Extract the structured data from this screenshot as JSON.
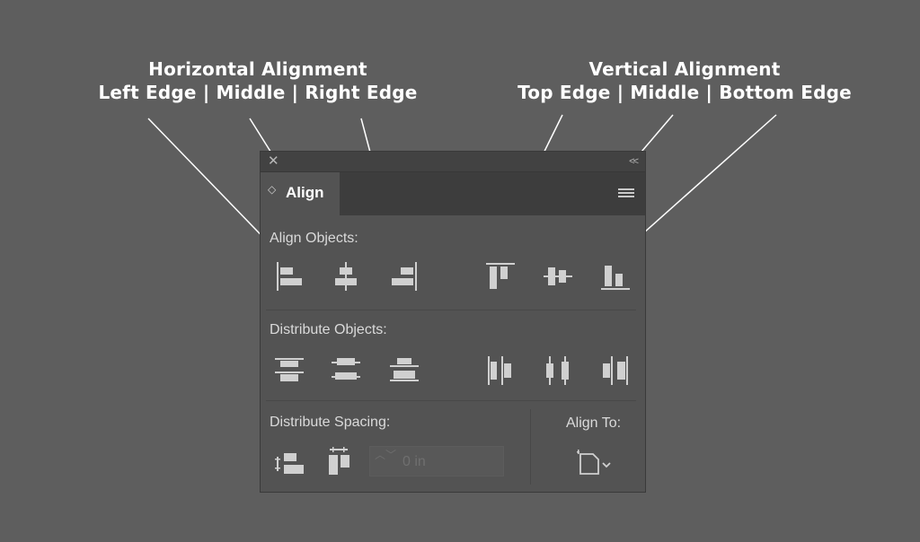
{
  "annotations": {
    "horizontal": {
      "title": "Horizontal Alignment",
      "subtitle": "Left Edge | Middle | Right Edge"
    },
    "vertical": {
      "title": "Vertical Alignment",
      "subtitle": "Top Edge | Middle | Bottom Edge"
    }
  },
  "panel": {
    "tab_label": "Align",
    "close_glyph": "✕",
    "collapse_glyph": "<<",
    "tab_arrows_glyph": "◇",
    "align_objects_label": "Align Objects:",
    "distribute_objects_label": "Distribute Objects:",
    "distribute_spacing_label": "Distribute Spacing:",
    "align_to_label": "Align To:",
    "spacing_value": "0 in",
    "spin_glyph": "︿﹀"
  },
  "colors": {
    "background": "#5e5e5e",
    "panel": "#535353",
    "titlebar": "#424242",
    "icon": "#d0d0d0",
    "annotation_text": "#ffffff"
  },
  "icons": [
    "align-left-edges-icon",
    "align-horizontal-centers-icon",
    "align-right-edges-icon",
    "align-top-edges-icon",
    "align-vertical-centers-icon",
    "align-bottom-edges-icon",
    "distribute-top-edges-icon",
    "distribute-vertical-centers-icon",
    "distribute-bottom-edges-icon",
    "distribute-left-edges-icon",
    "distribute-horizontal-centers-icon",
    "distribute-right-edges-icon",
    "distribute-vertical-space-icon",
    "distribute-horizontal-space-icon",
    "align-to-artboard-icon"
  ]
}
